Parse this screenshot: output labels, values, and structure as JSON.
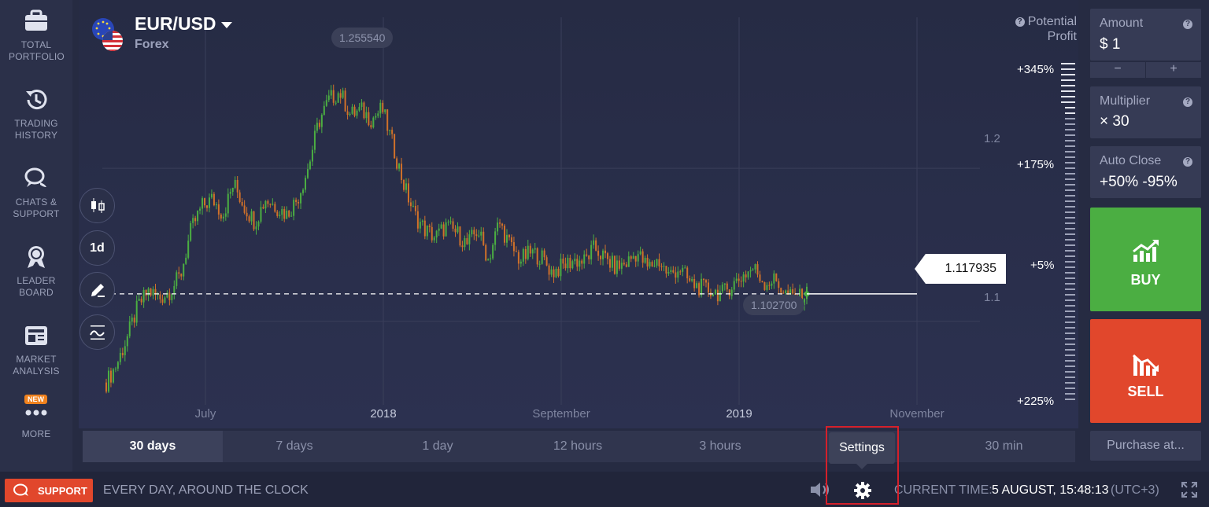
{
  "sidebar": {
    "items": [
      {
        "label": "Total Portfolio",
        "icon": "briefcase-icon"
      },
      {
        "label": "Trading History",
        "icon": "history-icon"
      },
      {
        "label": "Chats & Support",
        "icon": "chat-icon"
      },
      {
        "label": "Leader Board",
        "icon": "award-icon"
      },
      {
        "label": "Market Analysis",
        "icon": "newspaper-icon"
      },
      {
        "label": "More",
        "icon": "dots-icon",
        "badge": "NEW"
      }
    ]
  },
  "asset": {
    "name": "EUR/USD",
    "type": "Forex"
  },
  "chart": {
    "high_label": "1.255540",
    "low_label": "1.102700",
    "current_price": "1.117935",
    "y_ticks": [
      "1.2",
      "1.1"
    ],
    "x_ticks": [
      "July",
      "2018",
      "September",
      "2019",
      "November"
    ]
  },
  "chart_data": {
    "type": "line",
    "title": "",
    "xlabel": "",
    "ylabel": "",
    "x_ticks": [
      "July",
      "2018",
      "September",
      "2019",
      "November"
    ],
    "y_ticks": [
      "1.2",
      "1.1"
    ],
    "ylim": [
      1.03,
      1.31
    ],
    "series": [
      {
        "name": "",
        "values": [
          1.06,
          1.072,
          1.09,
          1.11,
          1.12,
          1.115,
          1.12,
          1.13,
          1.16,
          1.175,
          1.18,
          1.17,
          1.19,
          1.175,
          1.165,
          1.18,
          1.175,
          1.17,
          1.18,
          1.2,
          1.23,
          1.245,
          1.25,
          1.235,
          1.238,
          1.232,
          1.239,
          1.215,
          1.19,
          1.17,
          1.16,
          1.155,
          1.162,
          1.158,
          1.15,
          1.16,
          1.14,
          1.165,
          1.15,
          1.14,
          1.145,
          1.142,
          1.132,
          1.136,
          1.14,
          1.139,
          1.148,
          1.141,
          1.135,
          1.138,
          1.145,
          1.135,
          1.14,
          1.13,
          1.135,
          1.125,
          1.122,
          1.12,
          1.118,
          1.124,
          1.13,
          1.135,
          1.125,
          1.127,
          1.118,
          1.114,
          1.118
        ]
      }
    ],
    "annotations": {
      "high": 1.25554,
      "low": 1.1027,
      "current": 1.117935
    },
    "grid": true
  },
  "profit": {
    "title_line1": "Potential",
    "title_line2": "Profit",
    "labels": [
      "+345%",
      "+175%",
      "+5%",
      "+225%"
    ]
  },
  "tools": {
    "chart_type_icon": "candlestick-icon",
    "interval": "1d",
    "draw_icon": "pencil-icon",
    "indicator_icon": "indicator-icon"
  },
  "trade_panel": {
    "amount_label": "Amount",
    "amount_value": "$ 1",
    "minus": "−",
    "plus": "+",
    "multiplier_label": "Multiplier",
    "multiplier_value": "× 30",
    "autoclose_label": "Auto Close",
    "autoclose_value": "+50% -95%",
    "buy_label": "BUY",
    "sell_label": "SELL",
    "purchase_label": "Purchase at..."
  },
  "timeframes": {
    "tabs": [
      "30 days",
      "7 days",
      "1 day",
      "12 hours",
      "3 hours",
      "30 min"
    ],
    "active": "30 days"
  },
  "tooltip": {
    "settings": "Settings"
  },
  "bottom_bar": {
    "support_label": "SUPPORT",
    "support_text": "EVERY DAY, AROUND THE CLOCK",
    "time_label": "CURRENT TIME:",
    "time_value": "5 AUGUST, 15:48:13",
    "time_zone": "(UTC+3)"
  },
  "colors": {
    "buy": "#4bae42",
    "sell": "#e1472c",
    "background": "#262b42",
    "highlight": "#d5202a"
  }
}
